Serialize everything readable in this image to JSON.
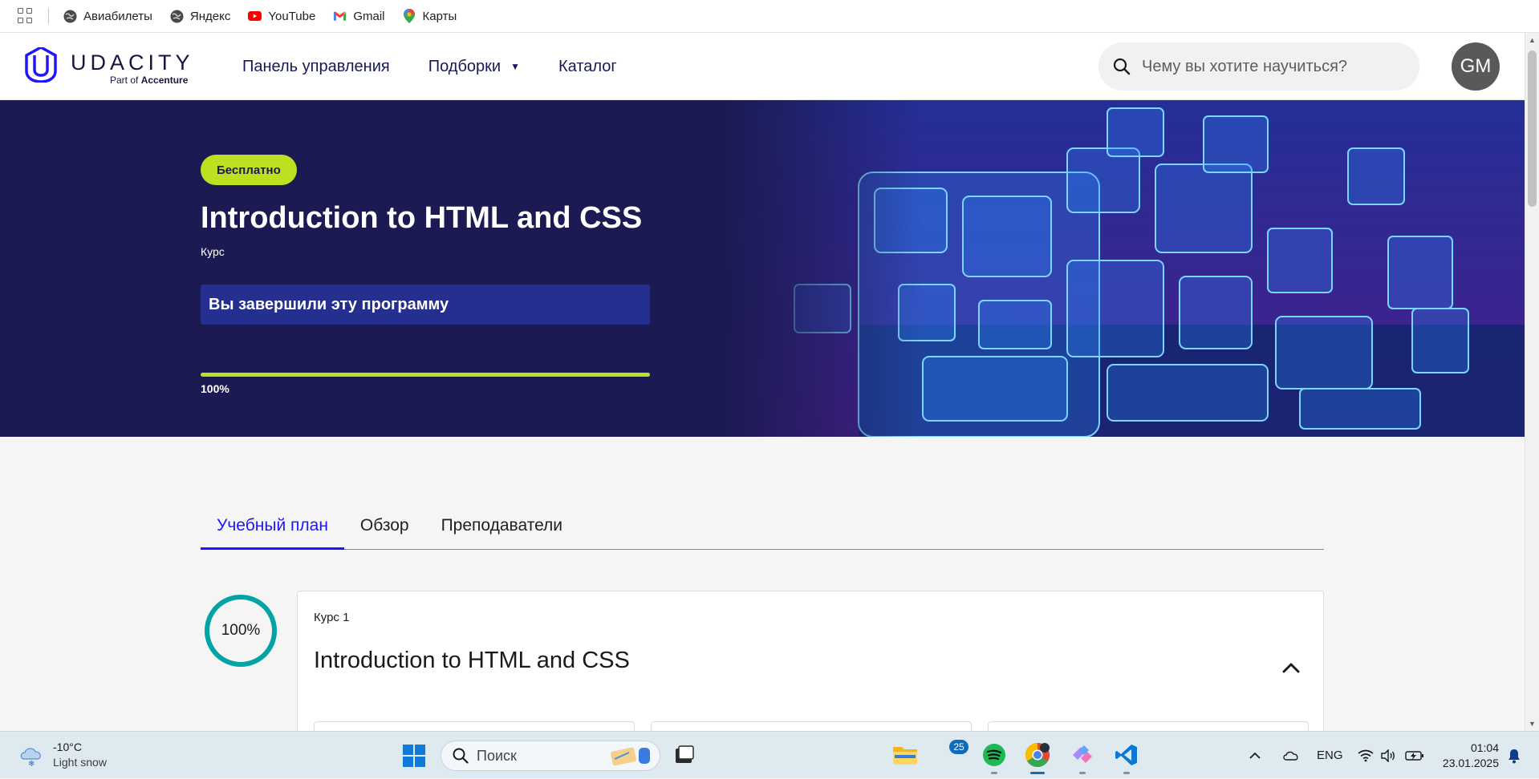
{
  "bookmarks": [
    {
      "label": "Авиабилеты",
      "icon": "globe-icon"
    },
    {
      "label": "Яндекс",
      "icon": "globe-icon"
    },
    {
      "label": "YouTube",
      "icon": "youtube-icon"
    },
    {
      "label": "Gmail",
      "icon": "gmail-icon"
    },
    {
      "label": "Карты",
      "icon": "maps-pin-icon"
    }
  ],
  "header": {
    "logo_text": "UDACITY",
    "logo_sub_prefix": "Part of ",
    "logo_sub_brand": "Accenture",
    "nav": {
      "dashboard": "Панель управления",
      "collections": "Подборки",
      "catalog": "Каталог"
    },
    "search_placeholder": "Чему вы хотите научиться?",
    "avatar_initials": "GM"
  },
  "hero": {
    "badge": "Бесплатно",
    "title": "Introduction to HTML and CSS",
    "kind": "Курс",
    "completed_text": "Вы завершили эту программу",
    "progress_value": 100,
    "progress_label": "100%"
  },
  "tabs": [
    {
      "label": "Учебный план",
      "active": true
    },
    {
      "label": "Обзор",
      "active": false
    },
    {
      "label": "Преподаватели",
      "active": false
    }
  ],
  "course": {
    "progress_value": 100,
    "progress_label": "100%",
    "kicker": "Курс 1",
    "title": "Introduction to HTML and CSS"
  },
  "taskbar": {
    "weather_temp": "-10°C",
    "weather_cond": "Light snow",
    "search_label": "Поиск",
    "notification_count": "25",
    "language": "ENG",
    "time": "01:04",
    "date": "23.01.2025"
  },
  "colors": {
    "brand_navy": "#1b1a52",
    "accent_lime": "#bde021",
    "tab_active": "#2015ff",
    "ring_teal": "#02a3a4"
  }
}
